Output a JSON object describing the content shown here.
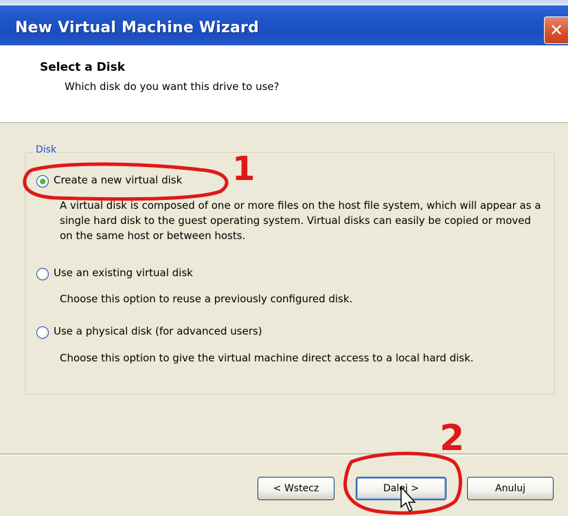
{
  "window": {
    "title": "New Virtual Machine Wizard",
    "close_glyph": "✕"
  },
  "header": {
    "title": "Select a Disk",
    "subtitle": "Which disk do you want this drive to use?"
  },
  "disk_group": {
    "label": "Disk",
    "options": [
      {
        "label": "Create a new virtual disk",
        "description": "A virtual disk is composed of one or more files on the host file system, which will appear as a single hard disk to the guest operating system. Virtual disks can easily be copied or moved on the same host or between hosts.",
        "checked": true
      },
      {
        "label": "Use an existing virtual disk",
        "description": "Choose this option to reuse a previously configured disk.",
        "checked": false
      },
      {
        "label": "Use a physical disk (for advanced users)",
        "description": "Choose this option to give the virtual machine direct access to a local hard disk.",
        "checked": false
      }
    ]
  },
  "buttons": {
    "back": "< Wstecz",
    "next": "Dalej >",
    "cancel": "Anuluj"
  },
  "annotations": {
    "marker_1": "1",
    "marker_2": "2",
    "color": "#e01818"
  }
}
